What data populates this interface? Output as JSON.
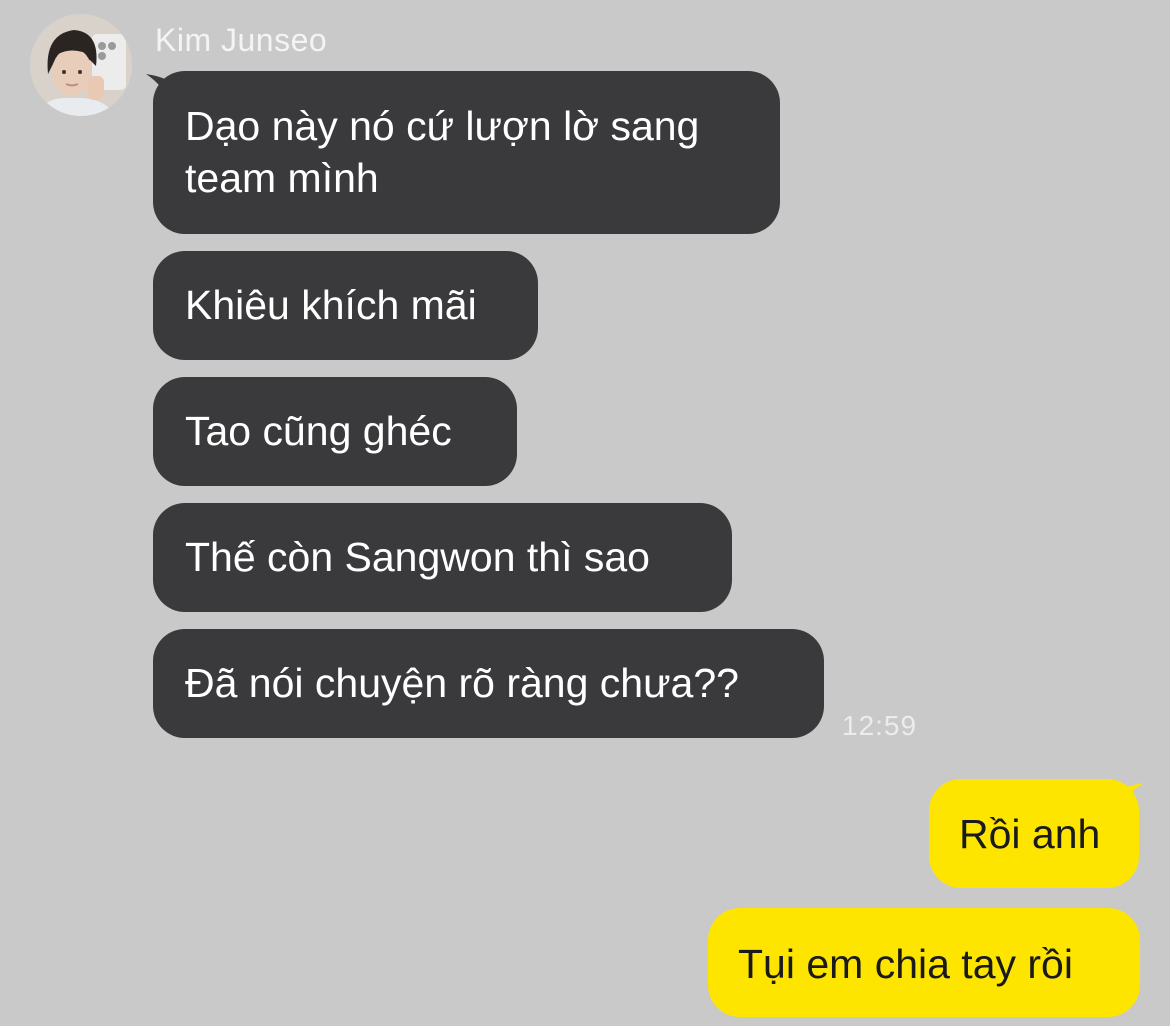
{
  "contact": {
    "name": "Kim Junseo",
    "avatar_icon": "profile-photo"
  },
  "incoming_messages": [
    {
      "lines": [
        "Dạo này nó cứ lượn lờ sang",
        "team mình"
      ]
    },
    {
      "lines": [
        "Khiêu khích mãi"
      ]
    },
    {
      "lines": [
        "Tao cũng ghéc"
      ]
    },
    {
      "lines": [
        "Thế còn Sangwon thì sao"
      ]
    },
    {
      "lines": [
        "Đã nói chuyện rõ ràng chưa??"
      ]
    }
  ],
  "incoming_timestamp": "12:59",
  "outgoing_messages": [
    {
      "text": "Rồi anh"
    },
    {
      "text": "Tụi em chia tay rồi"
    }
  ],
  "colors": {
    "background": "#c9c9c9",
    "incoming_bubble": "#3a3a3c",
    "outgoing_bubble": "#fee500",
    "incoming_text": "#ffffff",
    "outgoing_text": "#1a1a1a"
  }
}
